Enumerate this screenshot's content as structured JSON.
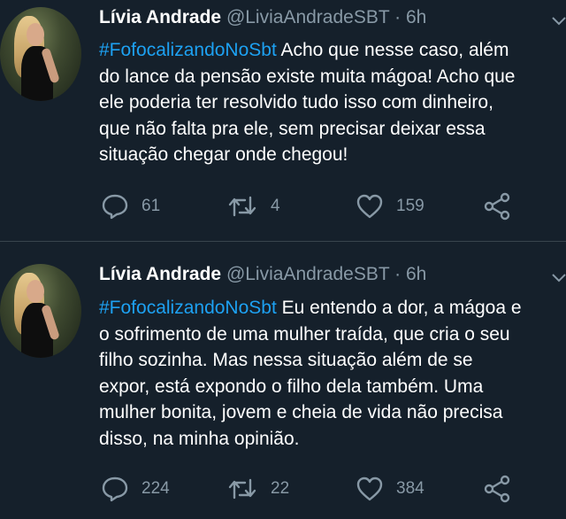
{
  "tweets": [
    {
      "author": {
        "name": "Lívia Andrade",
        "handle": "@LiviaAndradeSBT",
        "separator": "·",
        "time": "6h"
      },
      "hashtag": "#FofocalizandoNoSbt",
      "lines": [
        " Acho que nesse caso, além",
        "do lance da pensão existe muita mágoa! Acho que",
        "ele poderia ter resolvido tudo isso com dinheiro,",
        "que não falta pra ele, sem precisar deixar essa",
        "situação chegar onde chegou!"
      ],
      "actions": {
        "replies": "61",
        "retweets": "4",
        "likes": "159"
      }
    },
    {
      "author": {
        "name": "Lívia Andrade",
        "handle": "@LiviaAndradeSBT",
        "separator": "·",
        "time": "6h"
      },
      "hashtag": "#FofocalizandoNoSbt",
      "lines": [
        " Eu entendo a dor, a mágoa e",
        "o sofrimento de uma mulher traída, que cria o seu",
        "filho sozinha. Mas nessa situação além de se",
        "expor, está expondo o filho dela também. Uma",
        "mulher bonita, jovem e cheia de vida não precisa",
        "disso, na minha opinião."
      ],
      "actions": {
        "replies": "224",
        "retweets": "22",
        "likes": "384"
      }
    }
  ],
  "colors": {
    "background": "#15202b",
    "text": "#ffffff",
    "muted": "#8899a6",
    "hashtag": "#1da1f2",
    "divider": "#38444d"
  },
  "icons": [
    "reply-icon",
    "retweet-icon",
    "like-icon",
    "share-icon",
    "chevron-down-icon"
  ]
}
